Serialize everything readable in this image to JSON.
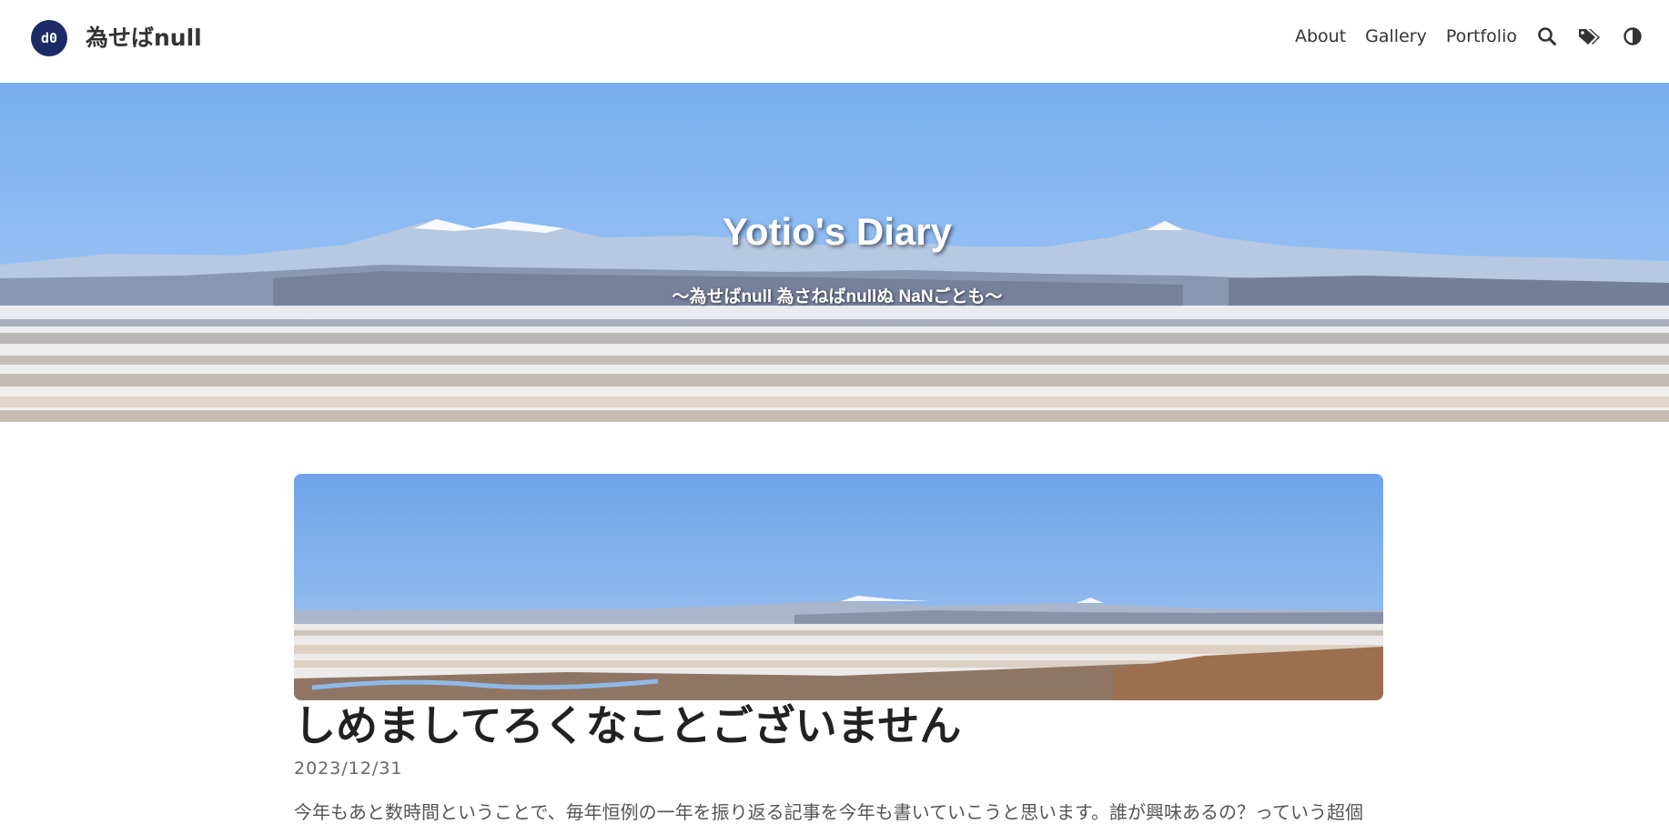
{
  "header": {
    "logo_text": "d0",
    "site_name": "為せばnull",
    "nav": [
      {
        "label": "About"
      },
      {
        "label": "Gallery"
      },
      {
        "label": "Portfolio"
      }
    ],
    "icons": [
      "search-icon",
      "tags-icon",
      "theme-toggle-icon"
    ]
  },
  "hero": {
    "title": "Yotio's Diary",
    "subtitle": "〜為せばnull 為さねばnullぬ NaNごとも〜"
  },
  "post": {
    "title": "しめましてろくなことございません",
    "date": "2023/12/31",
    "excerpt": "今年もあと数時間ということで、毎年恒例の一年を振り返る記事を今年も書いていこうと思います。誰が興味あるの？っていう超個"
  },
  "colors": {
    "logo_bg": "#1c2b66",
    "sky": "#7fb2ee",
    "snow": "#eef0f4"
  }
}
